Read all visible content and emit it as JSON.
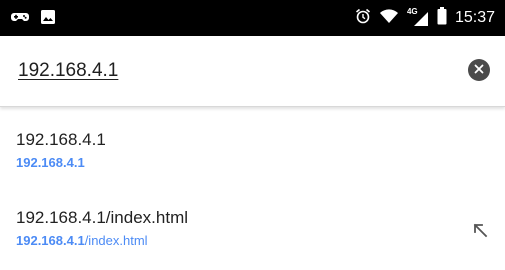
{
  "status_bar": {
    "left_icons": [
      "gamepad-icon",
      "image-icon"
    ],
    "right_icons": [
      "alarm-icon",
      "wifi-icon",
      "signal-4g-icon",
      "battery-icon"
    ],
    "network_label": "4G",
    "time": "15:37"
  },
  "search": {
    "value": "192.168.4.1",
    "clear_icon": "clear-icon"
  },
  "suggestions": [
    {
      "title": "192.168.4.1",
      "url_host": "192.168.4.1",
      "url_path": ""
    },
    {
      "title": "192.168.4.1/index.html",
      "url_host": "192.168.4.1",
      "url_path": "/index.html",
      "action_icon": "arrow-up-left-icon"
    }
  ],
  "colors": {
    "status_bar": "#000000",
    "link": "#4c8bf5",
    "text": "#222222",
    "clear_button": "#4a4a4a"
  }
}
